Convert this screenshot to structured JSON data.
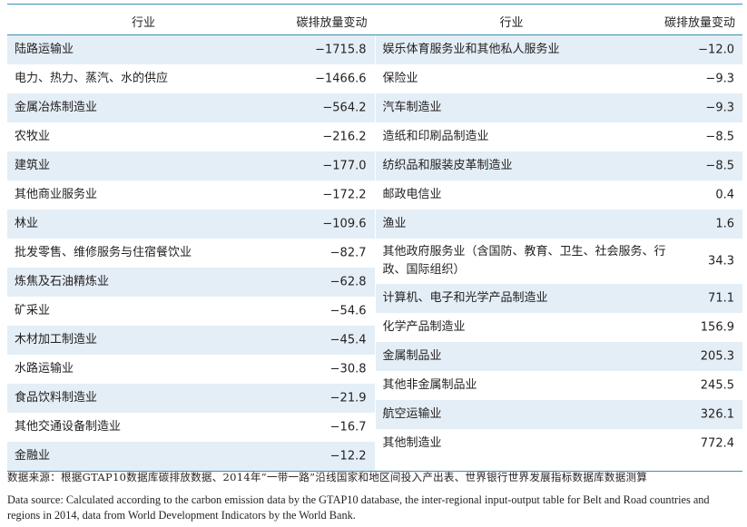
{
  "header": {
    "industry_label": "行业",
    "value_label": "碳排放量变动"
  },
  "left_rows": [
    {
      "name": "陆路运输业",
      "value": "−1715.8"
    },
    {
      "name": "电力、热力、蒸汽、水的供应",
      "value": "−1466.6"
    },
    {
      "name": "金属冶炼制造业",
      "value": "−564.2"
    },
    {
      "name": "农牧业",
      "value": "−216.2"
    },
    {
      "name": "建筑业",
      "value": "−177.0"
    },
    {
      "name": "其他商业服务业",
      "value": "−172.2"
    },
    {
      "name": "林业",
      "value": "−109.6"
    },
    {
      "name": "批发零售、维修服务与住宿餐饮业",
      "value": "−82.7"
    },
    {
      "name": "炼焦及石油精炼业",
      "value": "−62.8"
    },
    {
      "name": "矿采业",
      "value": "−54.6"
    },
    {
      "name": "木材加工制造业",
      "value": "−45.4"
    },
    {
      "name": "水路运输业",
      "value": "−30.8"
    },
    {
      "name": "食品饮料制造业",
      "value": "−21.9"
    },
    {
      "name": "其他交通设备制造业",
      "value": "−16.7"
    },
    {
      "name": "金融业",
      "value": "−12.2"
    }
  ],
  "right_rows": [
    {
      "name": "娱乐体育服务业和其他私人服务业",
      "value": "−12.0"
    },
    {
      "name": "保险业",
      "value": "−9.3"
    },
    {
      "name": "汽车制造业",
      "value": "−9.3"
    },
    {
      "name": "造纸和印刷品制造业",
      "value": "−8.5"
    },
    {
      "name": "纺织品和服装皮革制造业",
      "value": "−8.5"
    },
    {
      "name": "邮政电信业",
      "value": "0.4"
    },
    {
      "name": "渔业",
      "value": "1.6"
    },
    {
      "name": "其他政府服务业（含国防、教育、卫生、社会服务、行政、国际组织）",
      "value": "34.3"
    },
    {
      "name": "计算机、电子和光学产品制造业",
      "value": "71.1"
    },
    {
      "name": "化学产品制造业",
      "value": "156.9"
    },
    {
      "name": "金属制品业",
      "value": "205.3"
    },
    {
      "name": "其他非金属制品业",
      "value": "245.5"
    },
    {
      "name": "航空运输业",
      "value": "326.1"
    },
    {
      "name": "其他制造业",
      "value": "772.4"
    }
  ],
  "source_cn": "数据来源：根据GTAP10数据库碳排放数据、2014年“一带一路”沿线国家和地区间投入产出表、世界银行世界发展指标数据库数据测算",
  "source_en": "Data source: Calculated according to the carbon emission data by the GTAP10 database, the inter-regional input-output table for Belt and Road countries and regions in 2014, data from World Development Indicators by the World Bank.",
  "colors": {
    "rule": "#3a8fb7",
    "stripe": "#e4eef6"
  }
}
